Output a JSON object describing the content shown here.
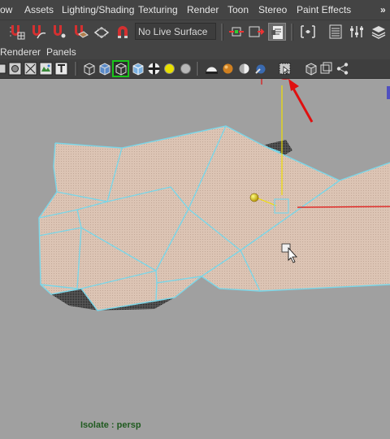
{
  "menubar": {
    "items": [
      "ow",
      "Assets",
      "Lighting/Shading",
      "Texturing",
      "Render",
      "Toon",
      "Stereo",
      "Paint Effects"
    ],
    "overflow": "»"
  },
  "toolbar": {
    "live_surface": "No Live Surface"
  },
  "panel_menu": {
    "items": [
      "Renderer",
      "Panels"
    ]
  },
  "viewport": {
    "status_label": "Isolate : persp",
    "mesh_color": "#dcc4b4",
    "wire_color": "#7ad6e8",
    "highlight_color": "#e01010"
  }
}
